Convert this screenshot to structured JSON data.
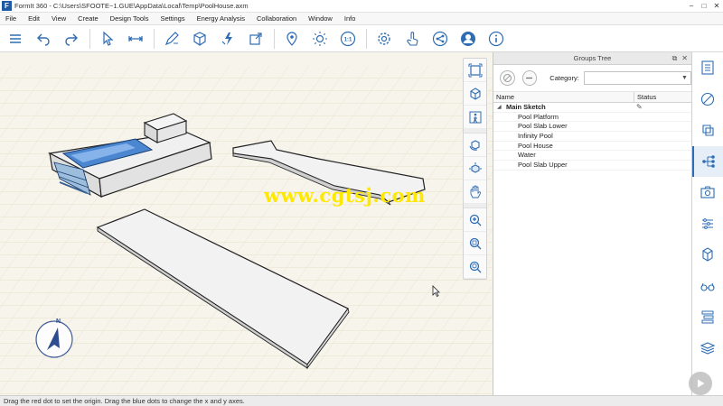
{
  "window": {
    "title": "FormIt 360 - C:\\Users\\SFOOTE~1.GUE\\AppData\\Local\\Temp\\PoolHouse.axm",
    "logo_letter": "F",
    "controls": [
      "–",
      "□",
      "✕"
    ]
  },
  "menu": [
    "File",
    "Edit",
    "View",
    "Create",
    "Design Tools",
    "Settings",
    "Energy Analysis",
    "Collaboration",
    "Window",
    "Info"
  ],
  "toolbar": {
    "icons": [
      "menu-icon",
      "undo-icon",
      "redo-icon",
      "select-icon",
      "dimension-icon",
      "sketch-pen-icon",
      "cube-icon",
      "edit-solid-icon",
      "scale-icon",
      "location-pin-icon",
      "sun-icon",
      "scale-1-1-icon",
      "settings-gear-icon",
      "touch-icon",
      "share-icon",
      "user-icon",
      "info-icon"
    ],
    "scale_badge": "1:1"
  },
  "viewport": {
    "watermark": "www.cgtsj.com",
    "compass_letter": "N"
  },
  "panel": {
    "title": "Groups Tree",
    "category_label": "Category:",
    "category_value": "",
    "columns": {
      "name": "Name",
      "status": "Status"
    },
    "root": "Main Sketch",
    "items": [
      "Pool Platform",
      "Pool Slab Lower",
      "Infinity Pool",
      "Pool House",
      "Water",
      "Pool Slab Upper"
    ]
  },
  "statusbar": {
    "text": "Drag the red dot to set the origin. Drag the blue dots to change the x and y axes."
  },
  "colors": {
    "accent": "#2e6db4",
    "viewport_bg": "#f6f3ea",
    "grid": "#e4dcc6",
    "watermark": "#ffe800"
  }
}
